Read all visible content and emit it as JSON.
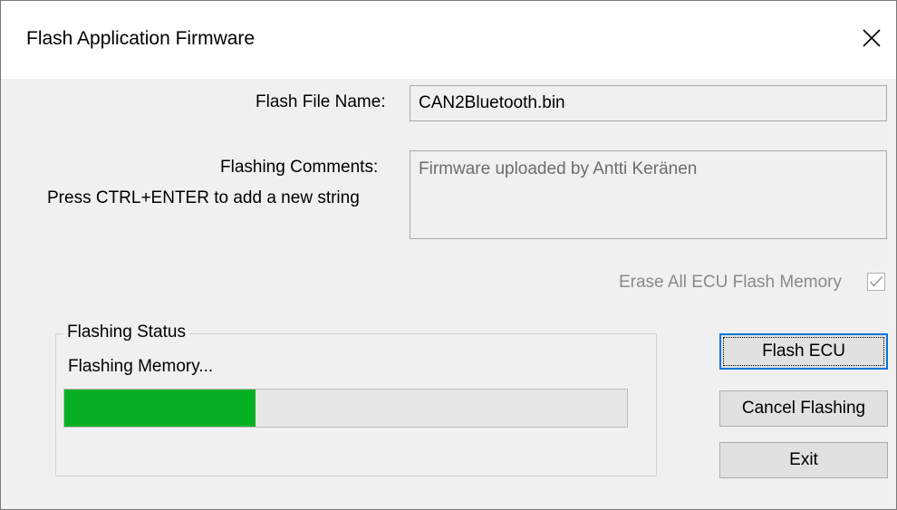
{
  "window": {
    "title": "Flash Application Firmware",
    "close_icon": "close-icon"
  },
  "form": {
    "file_name_label": "Flash File Name:",
    "file_name_value": "CAN2Bluetooth.bin",
    "comments_label": "Flashing Comments:",
    "comments_hint": "Press CTRL+ENTER to add a new string",
    "comments_value": "Firmware uploaded by Antti Keränen",
    "erase_label": "Erase All ECU Flash Memory",
    "erase_checked": true
  },
  "status": {
    "group_title": "Flashing Status",
    "message": "Flashing Memory...",
    "progress_percent": 34,
    "progress_color": "#06b025"
  },
  "buttons": {
    "flash": "Flash ECU",
    "cancel": "Cancel Flashing",
    "exit": "Exit"
  },
  "colors": {
    "accent": "#0078d7",
    "window_bg": "#f0f0f0",
    "titlebar_bg": "#ffffff"
  }
}
